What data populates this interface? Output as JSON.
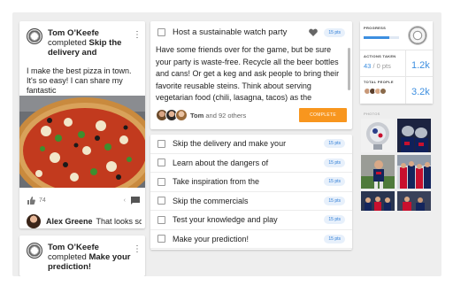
{
  "feed": {
    "post1": {
      "author": "Tom O’Keefe",
      "action": "completed",
      "task": "Skip the delivery and",
      "text": "I make the best pizza in town. It's so easy! I can share my fantastic",
      "likes": "74",
      "comment": {
        "author": "Alex Greene",
        "text": "That looks so"
      }
    },
    "post2": {
      "author": "Tom O’Keefe",
      "action": "completed",
      "task": "Make your prediction!"
    }
  },
  "featured_task": {
    "title": "Host a sustainable watch party",
    "points": "15 pts",
    "body": "Have some friends over for the game, but be sure your party is waste-free. Recycle all the beer bottles and cans! Or get a keg and ask people to bring their favorite reusable steins. Think about serving vegetarian food (chili, lasagna, tacos) as the",
    "participants_name": "Tom",
    "participants_rest": "and 92 others",
    "complete_label": "COMPLETE"
  },
  "tasks": [
    {
      "title": "Skip the delivery and make your",
      "points": "15 pts"
    },
    {
      "title": "Learn about the dangers of",
      "points": "15 pts"
    },
    {
      "title": "Take inspiration from the",
      "points": "15 pts"
    },
    {
      "title": "Skip the commercials",
      "points": "15 pts"
    },
    {
      "title": "Test your knowledge and play",
      "points": "15 pts"
    },
    {
      "title": "Make your prediction!",
      "points": "15 pts"
    }
  ],
  "stats": {
    "progress_label": "PROGRESS",
    "progress_fraction": 0.72,
    "actions_label": "ACTIONS TAKEN",
    "actions_value": "43",
    "actions_total": "/ 0 pts",
    "actions_big": "1.2k",
    "people_label": "TOTAL PEOPLE",
    "people_big": "3.2k"
  },
  "photos_label": "PHOTOS",
  "colors": {
    "accent": "#3d8fe0",
    "complete": "#f8961e",
    "pill_bg": "#e7f0fb"
  }
}
